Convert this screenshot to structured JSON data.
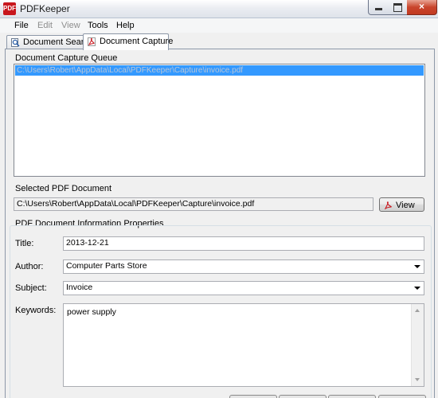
{
  "window": {
    "title": "PDFKeeper",
    "app_icon_text": "PDF",
    "controls": {
      "minimize": "minimize-icon",
      "maximize": "maximize-icon",
      "close": "×"
    }
  },
  "menu": [
    {
      "label": "File",
      "enabled": true
    },
    {
      "label": "Edit",
      "enabled": false
    },
    {
      "label": "View",
      "enabled": false
    },
    {
      "label": "Tools",
      "enabled": true
    },
    {
      "label": "Help",
      "enabled": true
    }
  ],
  "tabs": [
    {
      "label": "Document Search",
      "icon": "search-document-icon",
      "active": false
    },
    {
      "label": "Document Capture",
      "icon": "pdf-icon",
      "active": true
    }
  ],
  "capture_queue": {
    "label": "Document Capture Queue",
    "items": [
      "C:\\Users\\Robert\\AppData\\Local\\PDFKeeper\\Capture\\invoice.pdf"
    ],
    "selected_index": 0
  },
  "selected_document": {
    "label": "Selected PDF Document",
    "path": "C:\\Users\\Robert\\AppData\\Local\\PDFKeeper\\Capture\\invoice.pdf",
    "view_button": "View"
  },
  "properties": {
    "label": "PDF Document Information Properties",
    "title_label": "Title:",
    "title_value": "2013-12-21",
    "author_label": "Author:",
    "author_value": "Computer Parts Store",
    "subject_label": "Subject:",
    "subject_value": "Invoice",
    "keywords_label": "Keywords:",
    "keywords_value": "power supply"
  },
  "colors": {
    "selection": "#3399ff",
    "pdf_red": "#c8171e"
  }
}
